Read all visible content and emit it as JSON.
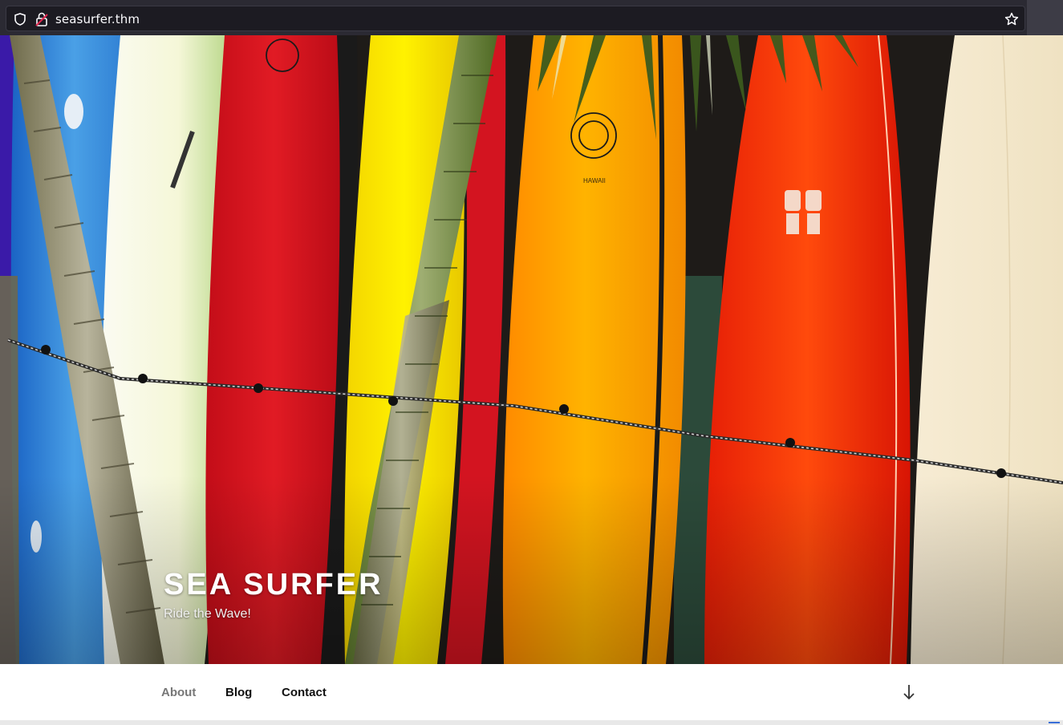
{
  "browser": {
    "url": "seasurfer.thm",
    "icons": [
      "shield-icon",
      "lock-icon",
      "star-icon"
    ]
  },
  "hero": {
    "title": "SEA SURFER",
    "subtitle": "Ride the Wave!"
  },
  "nav": {
    "items": [
      {
        "label": "About",
        "current": true
      },
      {
        "label": "Blog",
        "current": false
      },
      {
        "label": "Contact",
        "current": false
      }
    ],
    "scroll_icon": "arrow-down-icon"
  },
  "colors": {
    "chrome_bg": "#2b2a33",
    "urlbar_bg": "#1c1b22",
    "nav_current": "#777777",
    "nav_text": "#111111"
  }
}
